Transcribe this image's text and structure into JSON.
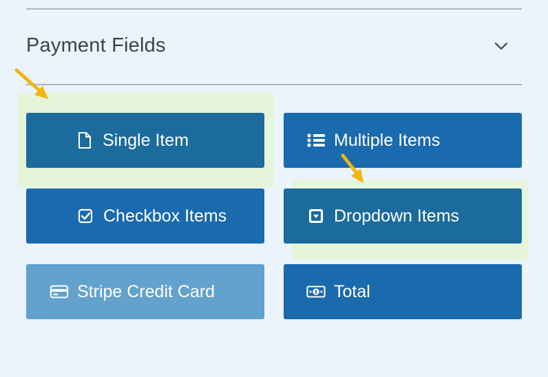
{
  "section": {
    "title": "Payment Fields",
    "toggle_icon": "chevron-down-icon"
  },
  "buttons": [
    {
      "label": "Single Item",
      "icon": "file-icon",
      "highlighted": true,
      "disabled": false
    },
    {
      "label": "Multiple Items",
      "icon": "list-icon",
      "highlighted": false,
      "disabled": false
    },
    {
      "label": "Checkbox Items",
      "icon": "checkbox-icon",
      "highlighted": false,
      "disabled": false
    },
    {
      "label": "Dropdown Items",
      "icon": "dropdown-icon",
      "highlighted": true,
      "disabled": false
    },
    {
      "label": "Stripe Credit Card",
      "icon": "credit-card-icon",
      "highlighted": false,
      "disabled": true
    },
    {
      "label": "Total",
      "icon": "money-icon",
      "highlighted": false,
      "disabled": false
    }
  ],
  "annotations": {
    "arrow_color": "#f2b50f",
    "highlight_color": "#dff5be"
  },
  "colors": {
    "button": "#1a6aae",
    "button_disabled": "#62a2cd",
    "background": "#ebf3fb",
    "title_text": "#3c434a"
  }
}
